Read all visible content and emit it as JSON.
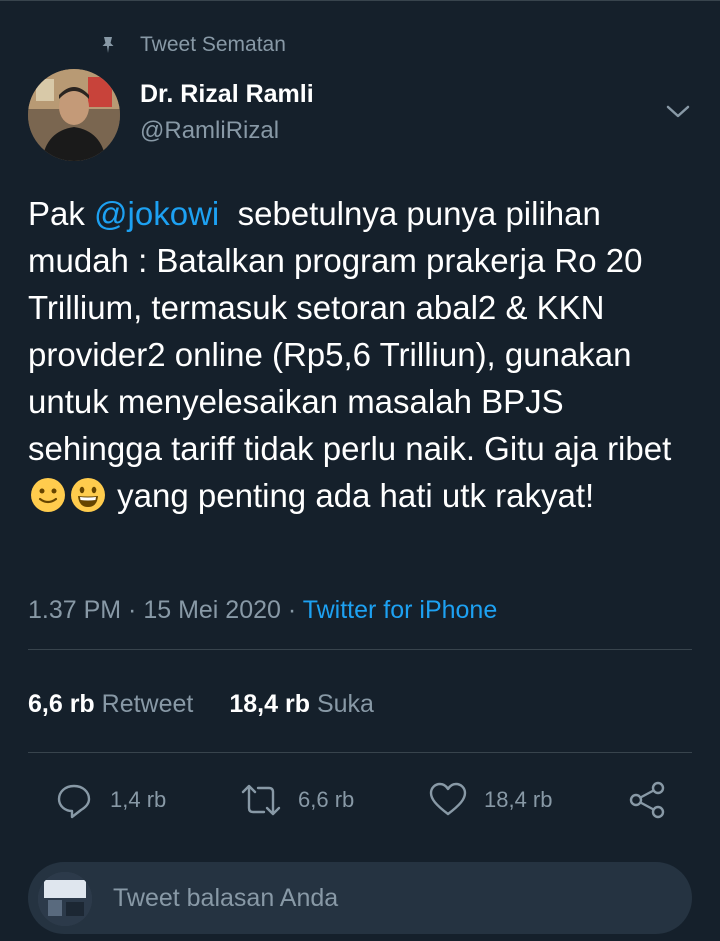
{
  "pinned_label": "Tweet Sematan",
  "author": {
    "name": "Dr. Rizal Ramli",
    "handle": "@RamliRizal"
  },
  "tweet": {
    "prefix": "Pak ",
    "mention": "@jokowi",
    "text_main": "  sebetulnya punya pilihan mudah : Batalkan program prakerja Ro 20 Trillium, termasuk setoran abal2 & KKN provider2 online (Rp5,6 Trilliun), gunakan untuk menyelesaikan masalah BPJS sehingga tariff tidak perlu naik. Gitu aja ribet ",
    "text_end": " yang penting ada hati utk rakyat!",
    "emojis": [
      "slightly-smiling-face",
      "grinning-face"
    ]
  },
  "meta": {
    "time": "1.37 PM",
    "sep1": " · ",
    "date": "15 Mei 2020",
    "sep2": " · ",
    "source": "Twitter for iPhone"
  },
  "stats": {
    "retweets_count": "6,6 rb",
    "retweets_label": "Retweet",
    "likes_count": "18,4 rb",
    "likes_label": "Suka"
  },
  "actions": {
    "reply_count": "1,4 rb",
    "retweet_count": "6,6 rb",
    "like_count": "18,4 rb"
  },
  "reply": {
    "placeholder": "Tweet balasan Anda"
  },
  "colors": {
    "background": "#15202b",
    "accent": "#1da1f2",
    "muted": "#8899a6",
    "divider": "#38444d"
  }
}
